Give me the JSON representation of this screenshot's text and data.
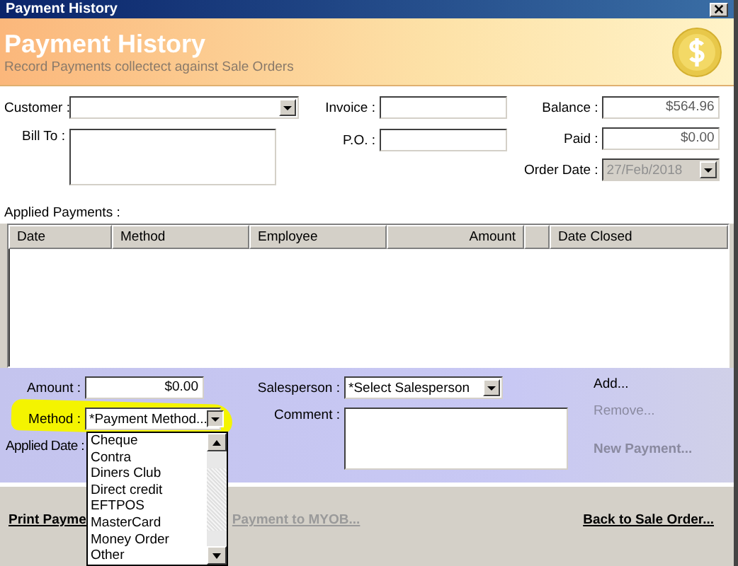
{
  "window": {
    "title": "Payment History"
  },
  "header": {
    "title": "Payment History",
    "subtitle": "Record Payments collectect against Sale Orders"
  },
  "form": {
    "customer": {
      "label": "Customer :"
    },
    "bill_to": {
      "label": "Bill To :"
    },
    "invoice": {
      "label": "Invoice :"
    },
    "po": {
      "label": "P.O. :"
    },
    "balance": {
      "label": "Balance :",
      "value": "$564.96"
    },
    "paid": {
      "label": "Paid :",
      "value": "$0.00"
    },
    "order_date": {
      "label": "Order Date :",
      "value": "27/Feb/2018",
      "disabled": true
    }
  },
  "applied_payments": {
    "label": "Applied Payments :",
    "columns": [
      {
        "label": "Date"
      },
      {
        "label": "Method"
      },
      {
        "label": "Employee"
      },
      {
        "label": "Amount"
      },
      {
        "label": "Date Closed"
      }
    ]
  },
  "payment": {
    "amount": {
      "label": "Amount :",
      "value": "$0.00"
    },
    "method": {
      "label": "Method :",
      "placeholder": "*Payment Method...",
      "highlighted": true,
      "expanded": true,
      "options": [
        "Cheque",
        "Contra",
        "Diners Club",
        "Direct credit",
        "EFTPOS",
        "MasterCard",
        "Money Order",
        "Other"
      ]
    },
    "applied_date": {
      "label": "Applied Date :"
    },
    "salesperson": {
      "label": "Salesperson :",
      "value": "*Select Salesperson"
    },
    "comment": {
      "label": "Comment :"
    },
    "actions": [
      {
        "label": "Add...",
        "disabled": false
      },
      {
        "label": "Remove...",
        "disabled": true
      },
      {
        "label": "New Payment...",
        "disabled": true
      }
    ]
  },
  "footer": [
    {
      "label": "Print Payme",
      "disabled": false
    },
    {
      "label": "Payment to MYOB...",
      "disabled": true
    },
    {
      "label": "Back to Sale Order...",
      "disabled": false
    }
  ]
}
